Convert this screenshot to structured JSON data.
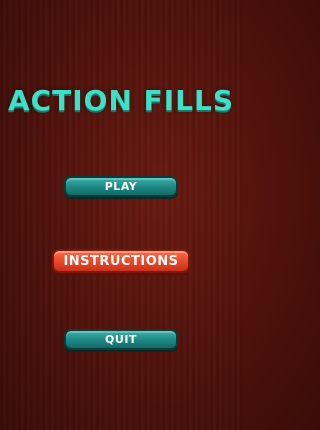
{
  "game": {
    "title": "ACTION FILLS"
  },
  "menu": {
    "play_label": "PLAY",
    "instructions_label": "INSTRUCTIONS",
    "quit_label": "QUIT"
  },
  "colors": {
    "background": "#4e120b",
    "title": "#3fe0c8",
    "teal_button": "#1f8a86",
    "red_button": "#e84728"
  }
}
